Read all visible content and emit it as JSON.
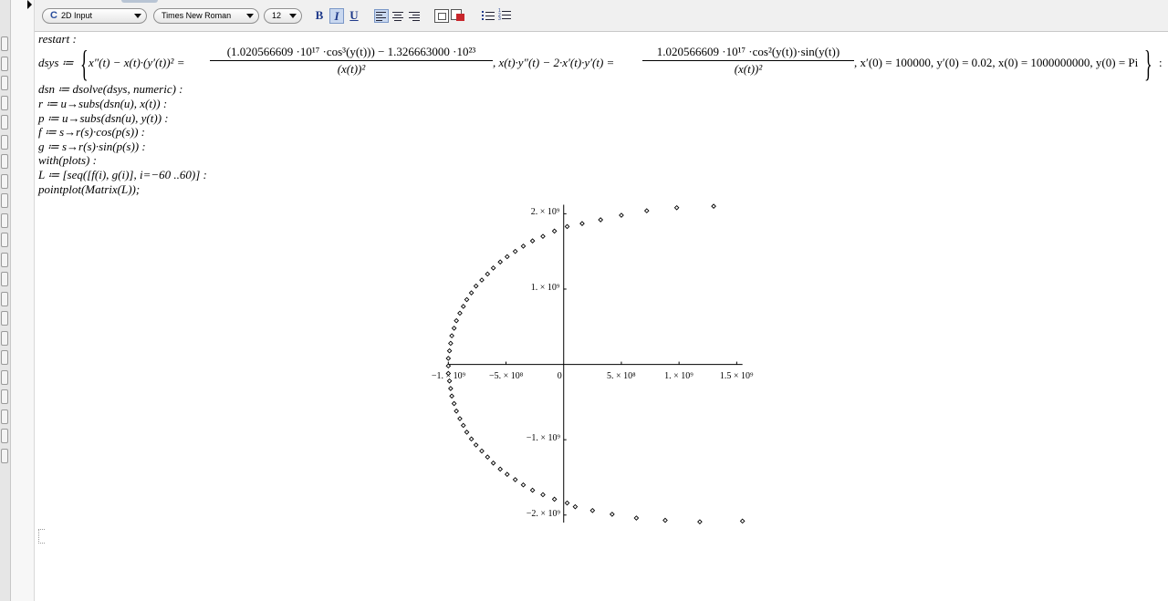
{
  "toolbar": {
    "mode_select": "2D Input",
    "mode_icon": "C",
    "font_select": "Times New Roman",
    "size_select": "12",
    "bold_label": "B",
    "italic_label": "I",
    "underline_label": "U",
    "icons": [
      "align-left-icon",
      "align-center-icon",
      "align-right-icon",
      "insert-table-icon",
      "color-icon",
      "bullet-list-icon",
      "numbered-list-icon"
    ]
  },
  "worksheet": {
    "line_restart": "restart :",
    "dsys": {
      "lhs": "dsys ≔",
      "eq1_lhs": "x″(t) − x(t)·(y′(t))² =",
      "frac1_num": "(1.020566609 ·10¹⁷ ·cos³(y(t))) − 1.326663000 ·10²³",
      "frac1_den": "(x(t))²",
      "eq2": ", x(t)·y″(t) − 2·x′(t)·y′(t) =",
      "frac2_num": "1.020566609 ·10¹⁷ ·cos²(y(t))·sin(y(t))",
      "frac2_den": "(x(t))²",
      "ics": ", x′(0) = 100000, y′(0) = 0.02, x(0) = 1000000000, y(0) = Pi",
      "tail": ":"
    },
    "line_dsn": "dsn ≔ dsolve(dsys, numeric) :",
    "line_r": "r ≔ u→subs(dsn(u), x(t)) :",
    "line_p": "p ≔ u→subs(dsn(u), y(t)) :",
    "line_f": "f ≔ s→r(s)·cos(p(s)) :",
    "line_g": "g ≔ s→r(s)·sin(p(s)) :",
    "line_with": "with(plots) :",
    "line_L": "L ≔ [seq([f(i), g(i)], i=−60 ..60)] :",
    "line_plot": "pointplot(Matrix(L));"
  },
  "chart_data": {
    "type": "scatter",
    "title": "",
    "xlabel": "",
    "ylabel": "",
    "x_ticks": [
      "−1. × 10⁹",
      "−5. × 10⁸",
      "0",
      "5. × 10⁸",
      "1. × 10⁹",
      "1.5 × 10⁹"
    ],
    "y_ticks": [
      "2. × 10⁹",
      "1. × 10⁹",
      "−1. × 10⁹",
      "−2. × 10⁹"
    ],
    "xlim": [
      -1050000000.0,
      1600000000.0
    ],
    "ylim": [
      -2100000000.0,
      2150000000.0
    ],
    "marker": "diamond",
    "color": "#000000",
    "points": [
      [
        1300000000.0,
        2100000000.0
      ],
      [
        980000000.0,
        2080000000.0
      ],
      [
        720000000.0,
        2040000000.0
      ],
      [
        500000000.0,
        1980000000.0
      ],
      [
        320000000.0,
        1920000000.0
      ],
      [
        160000000.0,
        1870000000.0
      ],
      [
        30000000.0,
        1830000000.0
      ],
      [
        -80000000.0,
        1770000000.0
      ],
      [
        -180000000.0,
        1700000000.0
      ],
      [
        -270000000.0,
        1640000000.0
      ],
      [
        -350000000.0,
        1570000000.0
      ],
      [
        -420000000.0,
        1500000000.0
      ],
      [
        -490000000.0,
        1430000000.0
      ],
      [
        -550000000.0,
        1360000000.0
      ],
      [
        -610000000.0,
        1280000000.0
      ],
      [
        -660000000.0,
        1200000000.0
      ],
      [
        -710000000.0,
        1120000000.0
      ],
      [
        -760000000.0,
        1040000000.0
      ],
      [
        -800000000.0,
        950000000.0
      ],
      [
        -840000000.0,
        860000000.0
      ],
      [
        -870000000.0,
        770000000.0
      ],
      [
        -900000000.0,
        680000000.0
      ],
      [
        -930000000.0,
        580000000.0
      ],
      [
        -950000000.0,
        480000000.0
      ],
      [
        -970000000.0,
        380000000.0
      ],
      [
        -980000000.0,
        280000000.0
      ],
      [
        -990000000.0,
        180000000.0
      ],
      [
        -1000000000.0,
        80000000.0
      ],
      [
        -1000000000.0,
        -20000000.0
      ],
      [
        -1000000000.0,
        -120000000.0
      ],
      [
        -990000000.0,
        -220000000.0
      ],
      [
        -980000000.0,
        -320000000.0
      ],
      [
        -970000000.0,
        -420000000.0
      ],
      [
        -950000000.0,
        -520000000.0
      ],
      [
        -930000000.0,
        -620000000.0
      ],
      [
        -900000000.0,
        -720000000.0
      ],
      [
        -870000000.0,
        -810000000.0
      ],
      [
        -840000000.0,
        -900000000.0
      ],
      [
        -800000000.0,
        -990000000.0
      ],
      [
        -760000000.0,
        -1070000000.0
      ],
      [
        -710000000.0,
        -1150000000.0
      ],
      [
        -660000000.0,
        -1230000000.0
      ],
      [
        -610000000.0,
        -1310000000.0
      ],
      [
        -550000000.0,
        -1390000000.0
      ],
      [
        -490000000.0,
        -1460000000.0
      ],
      [
        -420000000.0,
        -1530000000.0
      ],
      [
        -350000000.0,
        -1600000000.0
      ],
      [
        -270000000.0,
        -1670000000.0
      ],
      [
        -180000000.0,
        -1730000000.0
      ],
      [
        -80000000.0,
        -1790000000.0
      ],
      [
        30000000.0,
        -1840000000.0
      ],
      [
        100000000.0,
        -1890000000.0
      ],
      [
        250000000.0,
        -1940000000.0
      ],
      [
        420000000.0,
        -1990000000.0
      ],
      [
        630000000.0,
        -2040000000.0
      ],
      [
        880000000.0,
        -2070000000.0
      ],
      [
        1180000000.0,
        -2090000000.0
      ],
      [
        1550000000.0,
        -2080000000.0
      ]
    ]
  }
}
